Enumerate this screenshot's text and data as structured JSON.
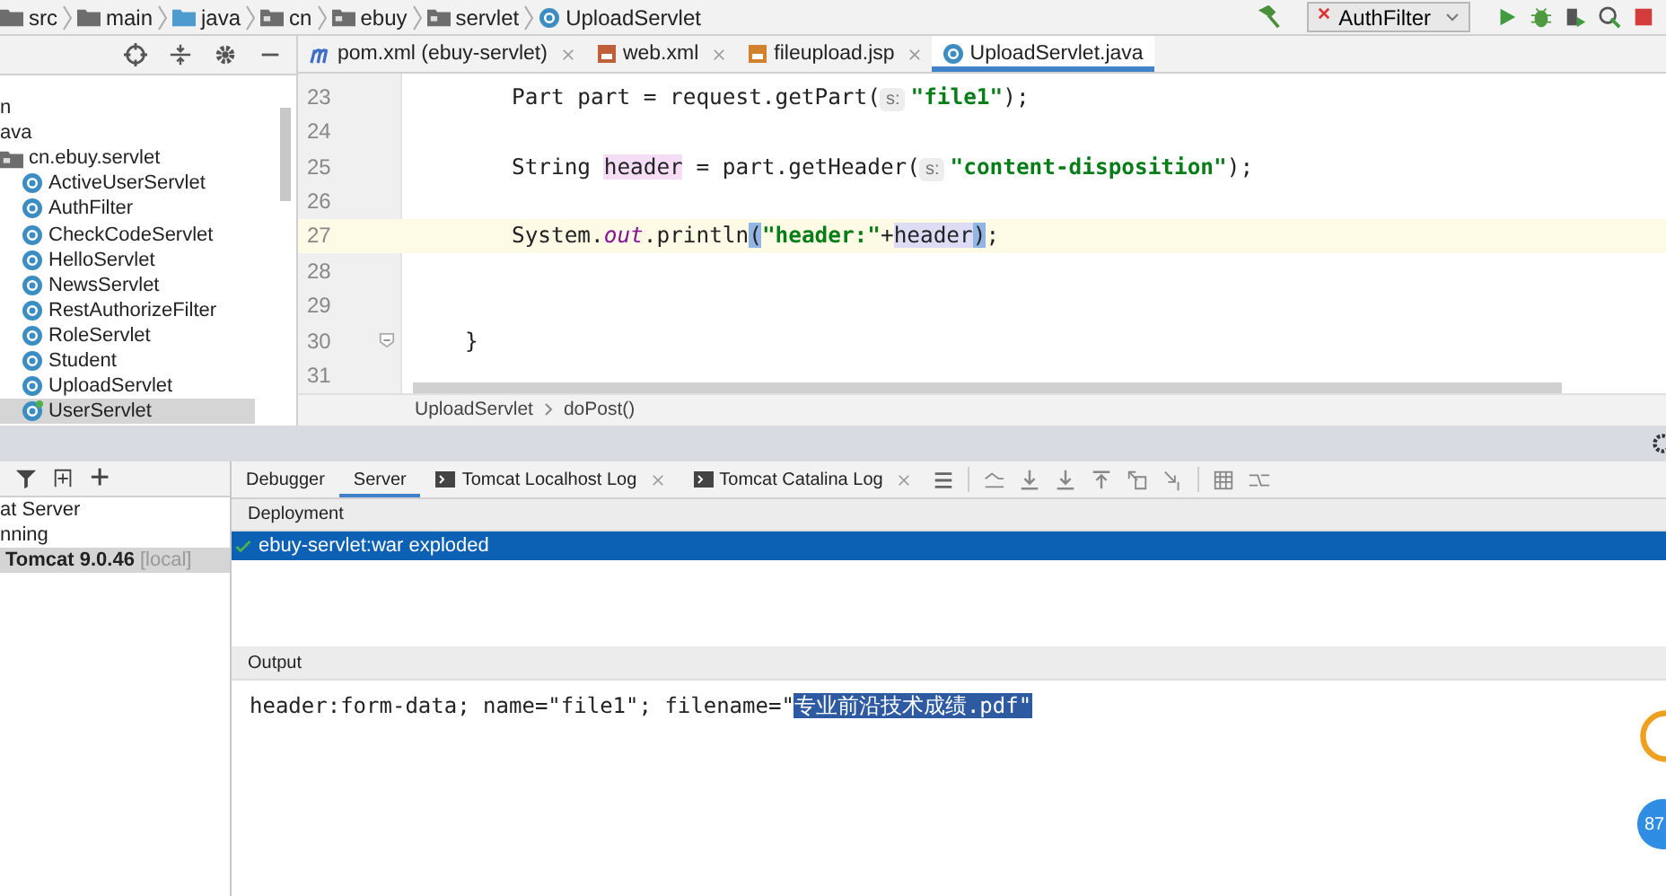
{
  "breadcrumbs": [
    {
      "label": "src",
      "kind": "folder"
    },
    {
      "label": "main",
      "kind": "folder"
    },
    {
      "label": "java",
      "kind": "source"
    },
    {
      "label": "cn",
      "kind": "package"
    },
    {
      "label": "ebuy",
      "kind": "package"
    },
    {
      "label": "servlet",
      "kind": "package"
    },
    {
      "label": "UploadServlet",
      "kind": "class"
    }
  ],
  "run_config": "AuthFilter",
  "editor_tabs": [
    {
      "label": "pom.xml (ebuy-servlet)",
      "kind": "maven",
      "selected": false
    },
    {
      "label": "web.xml",
      "kind": "xml",
      "selected": false
    },
    {
      "label": "fileupload.jsp",
      "kind": "jsp",
      "selected": false
    },
    {
      "label": "UploadServlet.java",
      "kind": "class",
      "selected": true
    }
  ],
  "project_tree": [
    {
      "label": "n"
    },
    {
      "label": "ava"
    },
    {
      "label": "cn.ebuy.servlet",
      "kind": "package",
      "children": [
        {
          "label": "ActiveUserServlet",
          "kind": "class",
          "selected": false
        },
        {
          "label": "AuthFilter",
          "kind": "class",
          "selected": false
        },
        {
          "label": "CheckCodeServlet",
          "kind": "class",
          "selected": false
        },
        {
          "label": "HelloServlet",
          "kind": "class",
          "selected": false
        },
        {
          "label": "NewsServlet",
          "kind": "class",
          "selected": false
        },
        {
          "label": "RestAuthorizeFilter",
          "kind": "class",
          "selected": false
        },
        {
          "label": "RoleServlet",
          "kind": "class",
          "selected": false
        },
        {
          "label": "Student",
          "kind": "class",
          "selected": false
        },
        {
          "label": "UploadServlet",
          "kind": "class",
          "selected": false
        },
        {
          "label": "UserServlet",
          "kind": "servlet",
          "selected": true
        }
      ]
    }
  ],
  "code_lines": [
    {
      "number": "23",
      "current": false,
      "kind": "statement",
      "tokens": [
        {
          "text": "Part part = request.getPart(",
          "kind": "plain"
        },
        {
          "text": "s:",
          "kind": "hint"
        },
        {
          "text": "\"file1\"",
          "kind": "string"
        },
        {
          "text": ");",
          "kind": "plain"
        }
      ]
    },
    {
      "number": "24",
      "current": false,
      "kind": "blank"
    },
    {
      "number": "25",
      "current": false,
      "kind": "statement",
      "tokens": [
        {
          "text": "String ",
          "kind": "plain"
        },
        {
          "text": "header",
          "kind": "declaration"
        },
        {
          "text": " = part.getHeader(",
          "kind": "plain"
        },
        {
          "text": "s:",
          "kind": "hint"
        },
        {
          "text": "\"content-disposition\"",
          "kind": "string"
        },
        {
          "text": ");",
          "kind": "plain"
        }
      ]
    },
    {
      "number": "26",
      "current": false,
      "kind": "blank"
    },
    {
      "number": "27",
      "current": true,
      "kind": "statement",
      "tokens": [
        {
          "text": "System.",
          "kind": "plain"
        },
        {
          "text": "out",
          "kind": "field"
        },
        {
          "text": ".println",
          "kind": "plain"
        },
        {
          "text": "(",
          "kind": "brace"
        },
        {
          "text": "\"header:\"",
          "kind": "string"
        },
        {
          "text": "+",
          "kind": "plain"
        },
        {
          "text": "header",
          "kind": "usage"
        },
        {
          "text": ")",
          "kind": "brace"
        },
        {
          "text": ";",
          "kind": "plain"
        }
      ]
    },
    {
      "number": "28",
      "current": false,
      "kind": "blank"
    },
    {
      "number": "29",
      "current": false,
      "kind": "blank"
    },
    {
      "number": "30",
      "current": false,
      "kind": "block_end",
      "tokens": [
        {
          "text": "}",
          "kind": "plain"
        }
      ]
    },
    {
      "number": "31",
      "current": false,
      "kind": "blank"
    }
  ],
  "code_breadcrumbs": [
    "UploadServlet",
    "doPost()"
  ],
  "services_tree": [
    {
      "label": "at Server",
      "selected": false
    },
    {
      "label": "nning",
      "selected": false
    },
    {
      "label": "Tomcat 9.0.46",
      "suffix": "[local]",
      "selected": true
    }
  ],
  "service_tabs": [
    {
      "label": "Debugger",
      "kind": "plain",
      "selected": false
    },
    {
      "label": "Server",
      "kind": "plain",
      "selected": true
    },
    {
      "label": "Tomcat Localhost Log",
      "kind": "log",
      "selected": false
    },
    {
      "label": "Tomcat Catalina Log",
      "kind": "log",
      "selected": false
    }
  ],
  "deployment": {
    "title": "Deployment",
    "items": [
      {
        "label": "ebuy-servlet:war exploded",
        "selected": true
      }
    ]
  },
  "output": {
    "title": "Output",
    "segments": [
      {
        "text": "header:form-data; name=\"file1\"; filename=\"",
        "selected": false
      },
      {
        "text": "专业前沿技术成绩.pdf\"",
        "selected": true
      }
    ]
  },
  "floating_badge": "87"
}
